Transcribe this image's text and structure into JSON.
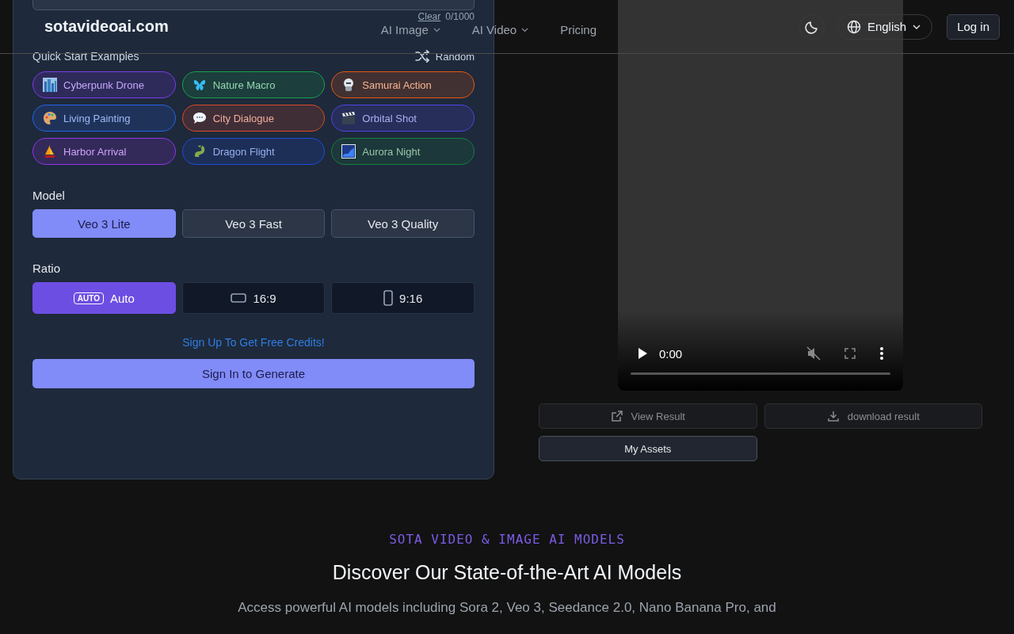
{
  "header": {
    "logo": "sotavideoai.com",
    "nav": [
      {
        "label": "AI Image",
        "dropdown": true
      },
      {
        "label": "AI Video",
        "dropdown": true
      },
      {
        "label": "Pricing",
        "dropdown": false
      }
    ],
    "language": "English",
    "login": "Log in"
  },
  "prompt": {
    "clear": "Clear",
    "counter": "0/1000"
  },
  "quick_start": {
    "title": "Quick Start Examples",
    "random": "Random",
    "examples": [
      {
        "label": "Cyberpunk Drone",
        "color": "#7c3aed"
      },
      {
        "label": "Nature Macro",
        "color": "#16a34a"
      },
      {
        "label": "Samurai Action",
        "color": "#ea580c"
      },
      {
        "label": "Living Painting",
        "color": "#2563eb"
      },
      {
        "label": "City Dialogue",
        "color": "#dc4a26"
      },
      {
        "label": "Orbital Shot",
        "color": "#4f46e5"
      },
      {
        "label": "Harbor Arrival",
        "color": "#9333ea"
      },
      {
        "label": "Dragon Flight",
        "color": "#1d4ed8"
      },
      {
        "label": "Aurora Night",
        "color": "#15803d"
      }
    ]
  },
  "model": {
    "label": "Model",
    "options": [
      {
        "label": "Veo 3 Lite",
        "selected": true
      },
      {
        "label": "Veo 3 Fast",
        "selected": false
      },
      {
        "label": "Veo 3 Quality",
        "selected": false
      }
    ]
  },
  "ratio": {
    "label": "Ratio",
    "options": [
      {
        "kind": "auto",
        "badge": "AUTO",
        "label": "Auto",
        "selected": true
      },
      {
        "kind": "landscape",
        "label": "16:9",
        "selected": false
      },
      {
        "kind": "portrait",
        "label": "9:16",
        "selected": false
      }
    ]
  },
  "signup_link": "Sign Up To Get Free Credits!",
  "generate_button": "Sign In to Generate",
  "player": {
    "time": "0:00",
    "muted": true,
    "level": 0
  },
  "result_buttons": [
    {
      "kind": "view",
      "label": "View Result",
      "disabled": true
    },
    {
      "kind": "download",
      "label": "download result",
      "disabled": true
    },
    {
      "kind": "assets",
      "label": "My Assets",
      "disabled": false
    }
  ],
  "models_section": {
    "eyebrow": "SOTA VIDEO & IMAGE AI MODELS",
    "heading": "Discover Our State-of-the-Art AI Models",
    "text": "Access powerful AI models including Sora 2, Veo 3, Seedance 2.0, Nano Banana Pro, and"
  }
}
